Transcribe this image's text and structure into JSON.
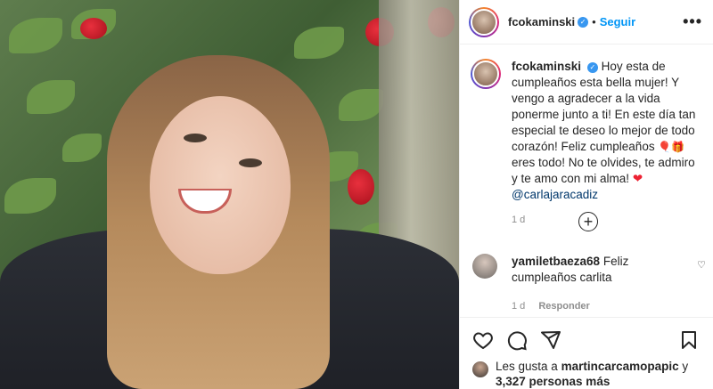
{
  "post": {
    "username": "fcokaminski",
    "follow_label": "Seguir",
    "more_label": "•••",
    "caption": {
      "username": "fcokaminski",
      "text_1": "Hoy esta de cumpleaños esta bella mujer! Y vengo a agradecer a la vida ponerme junto a ti! En este día tan especial te deseo lo mejor de todo corazón! Feliz cumpleaños",
      "emoji_1": "🎈🎁",
      "text_2": "eres todo! No te olvides, te admiro y te amo con mi alma!",
      "emoji_2": "❤",
      "mention": "@carlajaracadiz",
      "time": "1 d"
    },
    "load_more_label": "+",
    "comments": [
      {
        "username": "yamiletbaeza68",
        "text": "Feliz cumpleaños carlita",
        "time": "1 d",
        "reply_label": "Responder"
      }
    ],
    "likes": {
      "prefix": "Les gusta a",
      "user": "martincarcamopapic",
      "joiner": "y",
      "others": "3,327 personas más"
    },
    "icons": [
      "heart-icon",
      "comment-icon",
      "share-icon",
      "bookmark-icon",
      "verified-icon",
      "plus-circle-icon"
    ]
  }
}
